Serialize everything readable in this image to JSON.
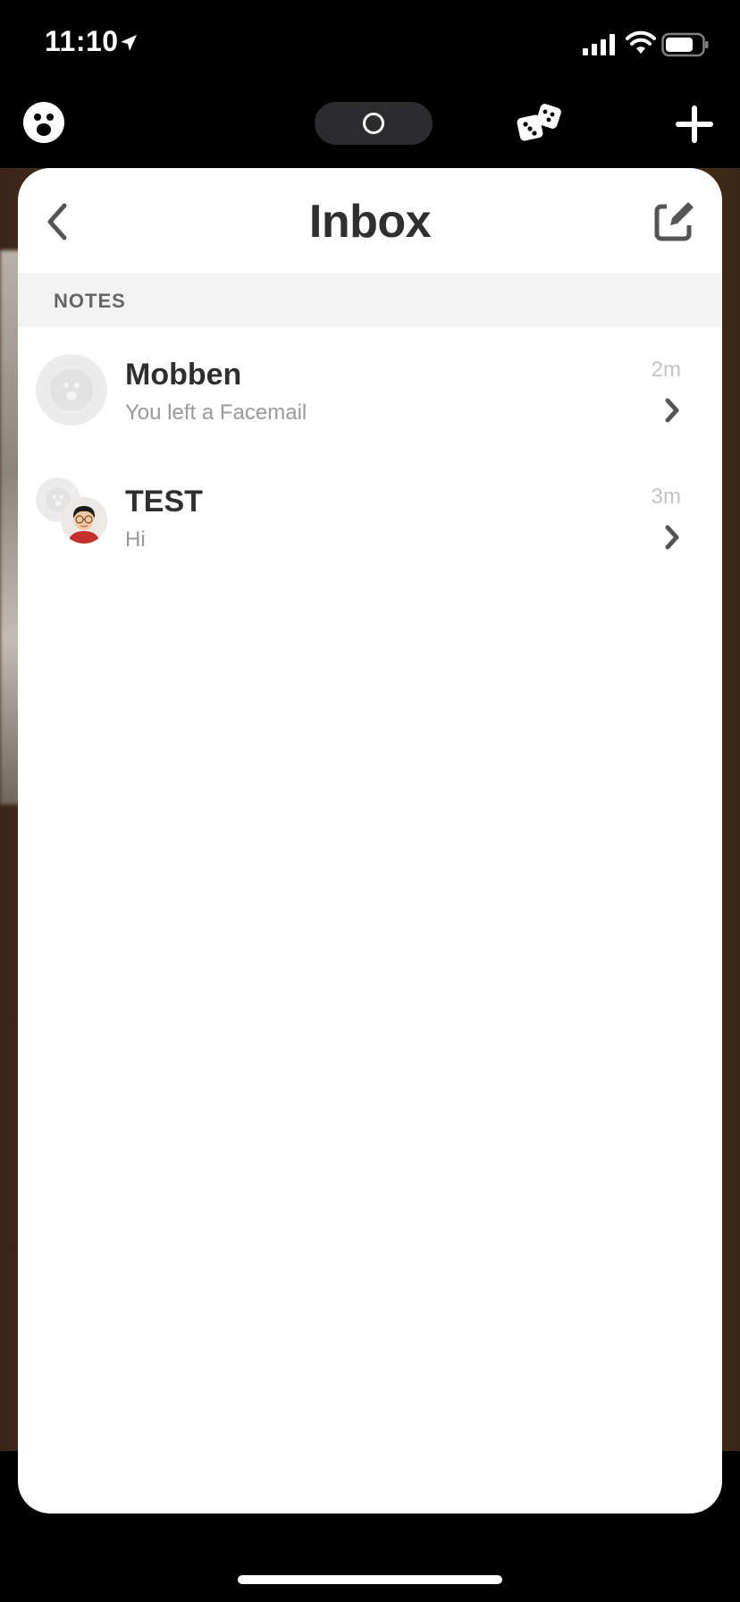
{
  "status_bar": {
    "time": "11:10",
    "icons": [
      "location-arrow-icon",
      "signal-bars-icon",
      "wifi-icon",
      "battery-icon"
    ]
  },
  "top_bar": {
    "icons": [
      "face-icon",
      "capture-icon",
      "dice-icon",
      "plus-icon"
    ]
  },
  "header": {
    "title": "Inbox",
    "icons": [
      "chevron-left-icon",
      "compose-icon"
    ]
  },
  "section": {
    "label": "NOTES"
  },
  "conversations": [
    {
      "name": "Mobben",
      "preview": "You left a Facemail",
      "time": "2m"
    },
    {
      "name": "TEST",
      "preview": "Hi",
      "time": "3m"
    }
  ],
  "colors": {
    "title": "#2f2f2f",
    "subtitle": "#9a9a9a",
    "timestamp": "#c4c4c4",
    "section_bg": "#f3f3f3",
    "card_bg": "#ffffff"
  }
}
